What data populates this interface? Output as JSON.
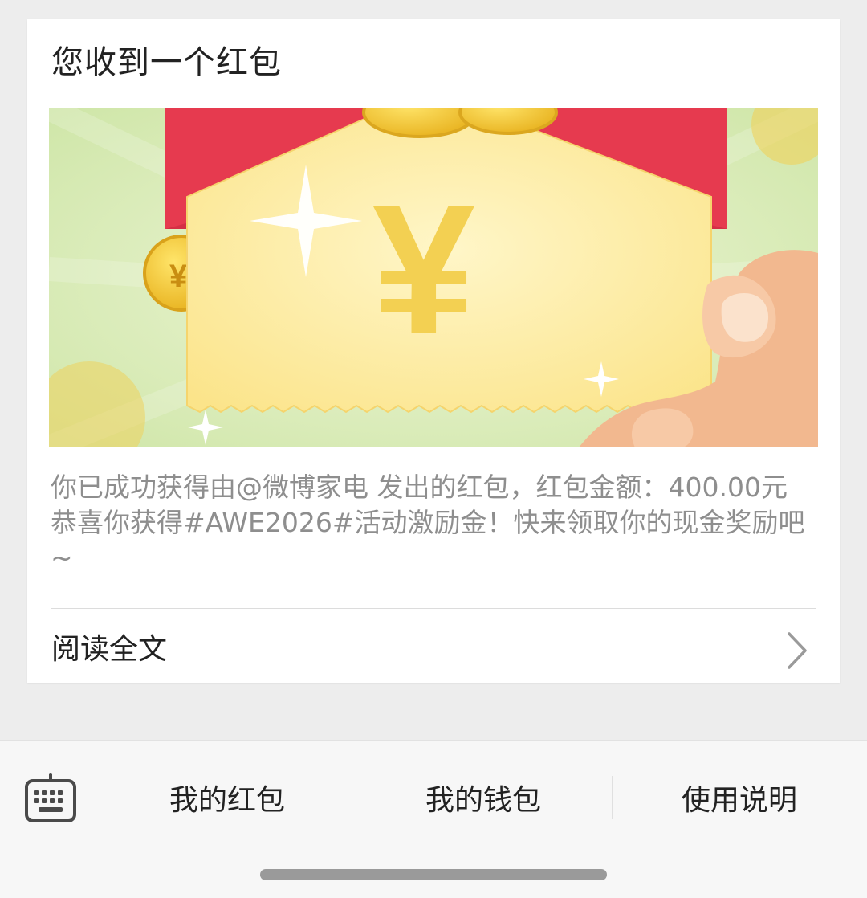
{
  "card": {
    "title": "您收到一个红包",
    "description": "你已成功获得由@微博家电 发出的红包，红包金额：400.00元 恭喜你获得#AWE2026#活动激励金！快来领取你的现金奖励吧~",
    "read_more_label": "阅读全文"
  },
  "banner": {
    "currency_symbol": "¥"
  },
  "bottom_menu": {
    "items": [
      {
        "label": "我的红包"
      },
      {
        "label": "我的钱包"
      },
      {
        "label": "使用说明"
      }
    ]
  },
  "icons": {
    "keyboard": "keyboard-icon",
    "chevron": "chevron-right-icon"
  },
  "colors": {
    "banner_background": "#d8ebb5",
    "envelope_red": "#e63a4f",
    "card_yellow": "#fdeca0",
    "coin_gold": "#f2c832"
  }
}
